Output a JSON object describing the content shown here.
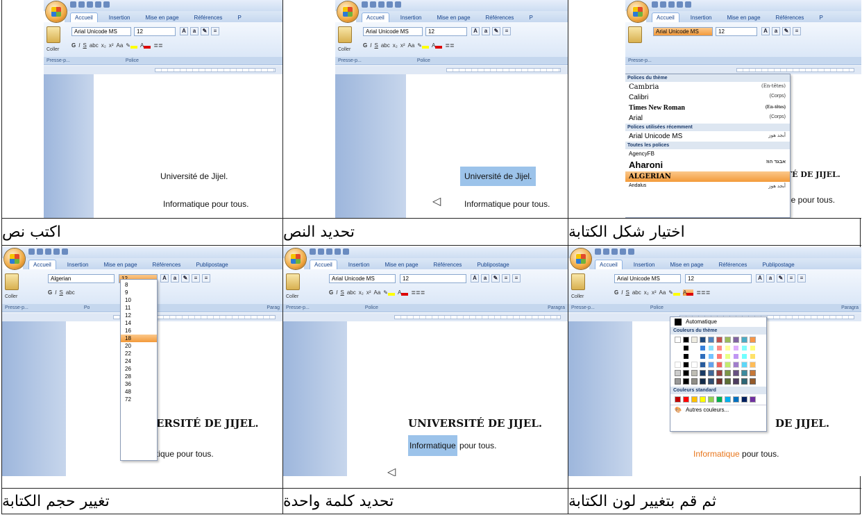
{
  "cells": [
    {
      "caption": "اختيار شكل الكتابة",
      "office": {
        "tabs": [
          "Accueil",
          "Insertion",
          "Mise en page",
          "Références",
          "P"
        ],
        "font": "Arial Unicode MS",
        "size": "12",
        "paste": "Coller",
        "group_clip": "Presse-p...",
        "group_font": "Police"
      },
      "doc": {
        "line1": "TÉ DE JIJEL.",
        "line2": "ue pour tous."
      },
      "font_menu": {
        "theme_header": "Polices du thème",
        "theme": [
          {
            "name": "Cambria",
            "tag": "(En-têtes)"
          },
          {
            "name": "Calibri",
            "tag": "(Corps)"
          },
          {
            "name": "Times New Roman",
            "tag": "(En-têtes)"
          },
          {
            "name": "Arial",
            "tag": "(Corps)"
          }
        ],
        "recent_header": "Polices utilisées récemment",
        "recent": [
          {
            "name": "Arial Unicode MS",
            "tag": "أبجد هوز"
          }
        ],
        "all_header": "Toutes les polices",
        "all": [
          {
            "name": "AgencyFB",
            "tag": ""
          },
          {
            "name": "Aharoni",
            "tag": "אבגד הוז"
          },
          {
            "name": "ALGERIAN",
            "tag": ""
          },
          {
            "name": "Andalus",
            "tag": "أبجد هوز"
          }
        ]
      }
    },
    {
      "caption": "تحديد النص",
      "office": {
        "tabs": [
          "Accueil",
          "Insertion",
          "Mise en page",
          "Références",
          "P"
        ],
        "font": "Arial Unicode MS",
        "size": "12",
        "paste": "Coller",
        "group_clip": "Presse-p...",
        "group_font": "Police"
      },
      "doc": {
        "line1": "Université de Jijel.",
        "line2": "Informatique pour tous."
      }
    },
    {
      "caption": "اكتب نص",
      "office": {
        "tabs": [
          "Accueil",
          "Insertion",
          "Mise en page",
          "Références",
          "P"
        ],
        "font": "Arial Unicode MS",
        "size": "12",
        "paste": "Coller",
        "group_clip": "Presse-p...",
        "group_font": "Police"
      },
      "doc": {
        "line1": "Université de Jijel.",
        "line2": "Informatique pour tous."
      }
    },
    {
      "caption": "ثم قم بتغيير لون الكتابة",
      "office": {
        "tabs": [
          "Accueil",
          "Insertion",
          "Mise en page",
          "Références",
          "Publipostage"
        ],
        "title_hint": "Docume",
        "font": "Arial Unicode MS",
        "size": "12",
        "paste": "Coller",
        "group_clip": "Presse-p...",
        "group_font": "Police",
        "group_para": "Paragra"
      },
      "doc": {
        "line1": "DE JIJEL.",
        "line2_colored": "Informatique",
        "line2_rest": " pour tous."
      },
      "color_menu": {
        "auto": "Automatique",
        "theme_header": "Couleurs du thème",
        "standard_header": "Couleurs standard",
        "more": "Autres couleurs..."
      }
    },
    {
      "caption": "تحديد كلمة واحدة",
      "office": {
        "tabs": [
          "Accueil",
          "Insertion",
          "Mise en page",
          "Références",
          "Publipostage"
        ],
        "title_hint": "Docume",
        "font": "Arial Unicode MS",
        "size": "12",
        "paste": "Coller",
        "group_clip": "Presse-p...",
        "group_font": "Police",
        "group_para": "Paragra"
      },
      "doc": {
        "line1": "UNIVERSITÉ DE JIJEL.",
        "line2_selected": "Informatique",
        "line2_rest": " pour tous."
      }
    },
    {
      "caption": "تغيير حجم الكتابة",
      "office": {
        "tabs": [
          "Accueil",
          "Insertion",
          "Mise en page",
          "Références",
          "Publipostage"
        ],
        "title_hint": "Docur",
        "font": "Algerian",
        "size": "12",
        "paste": "Coller",
        "group_clip": "Presse-p...",
        "group_font": "Po",
        "group_para": "Parag"
      },
      "doc": {
        "line1": "ERSITÉ DE JIJEL.",
        "line2": "tique pour tous."
      },
      "size_menu": {
        "sizes": [
          "8",
          "9",
          "10",
          "11",
          "12",
          "14",
          "16",
          "18",
          "20",
          "22",
          "24",
          "26",
          "28",
          "36",
          "48",
          "72"
        ],
        "highlighted": "18"
      }
    }
  ]
}
